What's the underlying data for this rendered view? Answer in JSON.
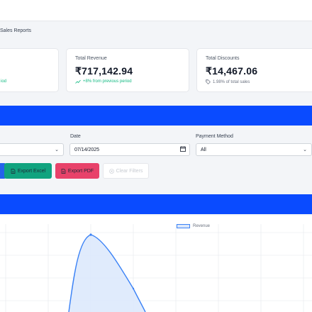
{
  "breadcrumb": "Sales Reports",
  "cards": [
    {
      "label": "",
      "value": "",
      "sub": "iod"
    },
    {
      "label": "Total Revenue",
      "value": "₹717,142.94",
      "sub": "+8% from previous period"
    },
    {
      "label": "Total Discounts",
      "value": "₹14,467.06",
      "sub": "1.98% of total sales"
    }
  ],
  "filters": {
    "date_label": "Date",
    "date_value": "07/14/2025",
    "payment_label": "Payment Method",
    "payment_value": "All"
  },
  "buttons": {
    "export_excel": "Export Excel",
    "export_pdf": "Export PDF",
    "clear_filters": "Clear Filters"
  },
  "icons": {
    "trend": "trend-up-icon",
    "tag": "tag-icon",
    "calendar": "calendar-icon",
    "chevron": "chevron-down-icon",
    "file": "file-icon",
    "clear": "clear-icon"
  },
  "colors": {
    "accent": "#0a4bff",
    "success": "#10a37f",
    "danger": "#e8426a",
    "series": "#3b82f6"
  },
  "chart_data": {
    "type": "area",
    "series": [
      {
        "name": "Revenue"
      }
    ],
    "legend": "top"
  }
}
